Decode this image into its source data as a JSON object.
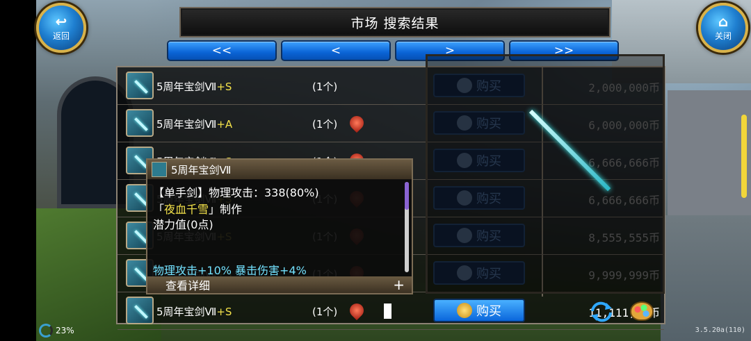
{
  "header": {
    "title": "市场  搜索结果",
    "back_label": "返回",
    "close_label": "关闭"
  },
  "pager": {
    "first": "<<",
    "prev": "<",
    "next": ">",
    "last": ">>"
  },
  "listings": [
    {
      "name": "5周年宝剑Ⅶ",
      "suffix": "+S",
      "qty": "(1个)",
      "buy": "购买",
      "price": "2,000,000币",
      "flame": false,
      "active": false
    },
    {
      "name": "5周年宝剑Ⅶ",
      "suffix": "+A",
      "qty": "(1个)",
      "buy": "购买",
      "price": "6,000,000币",
      "flame": true,
      "active": false
    },
    {
      "name": "5周年宝剑Ⅶ",
      "suffix": "+S",
      "qty": "(1个)",
      "buy": "购买",
      "price": "6,666,666币",
      "flame": true,
      "active": false
    },
    {
      "name": "5周年宝剑Ⅶ",
      "suffix": "+S",
      "qty": "(1个)",
      "buy": "购买",
      "price": "6,666,666币",
      "flame": true,
      "active": false
    },
    {
      "name": "5周年宝剑Ⅶ",
      "suffix": "+S",
      "qty": "(1个)",
      "buy": "购买",
      "price": "8,555,555币",
      "flame": true,
      "active": false
    },
    {
      "name": "5周年宝剑Ⅶ",
      "suffix": "+S",
      "qty": "(1个)",
      "buy": "购买",
      "price": "9,999,999币",
      "flame": true,
      "active": false
    },
    {
      "name": "5周年宝剑Ⅶ",
      "suffix": "+S",
      "qty": "(1个)",
      "buy": "购买",
      "price": "11,111,1 币",
      "flame": true,
      "active": true
    }
  ],
  "tooltip": {
    "title": "5周年宝剑Ⅶ",
    "line1": "【单手剑】物理攻击：338(80%)",
    "line2_pre": "「",
    "line2_hl": "夜血千雪",
    "line2_post": "」制作",
    "line3": "潜力值(0点)",
    "line4": "物理攻击+10% 暴击伤害+4%",
    "footer": "查看详细",
    "plus": "+"
  },
  "status": {
    "battery": "23%",
    "version": "3.5.20a(110)"
  },
  "icons": {
    "back": "return-arrow-icon",
    "close": "home-icon",
    "item": "sword-icon",
    "flame": "flame-icon",
    "coin": "coin-icon",
    "sync": "sync-icon",
    "palette": "palette-icon"
  },
  "colors": {
    "accent_blue": "#0a64d6",
    "suffix_yellow": "#f4e24a",
    "crafter_yellow": "#f4e24a",
    "bonus_cyan": "#73e2ff",
    "frame_gold": "#d8b24a"
  }
}
